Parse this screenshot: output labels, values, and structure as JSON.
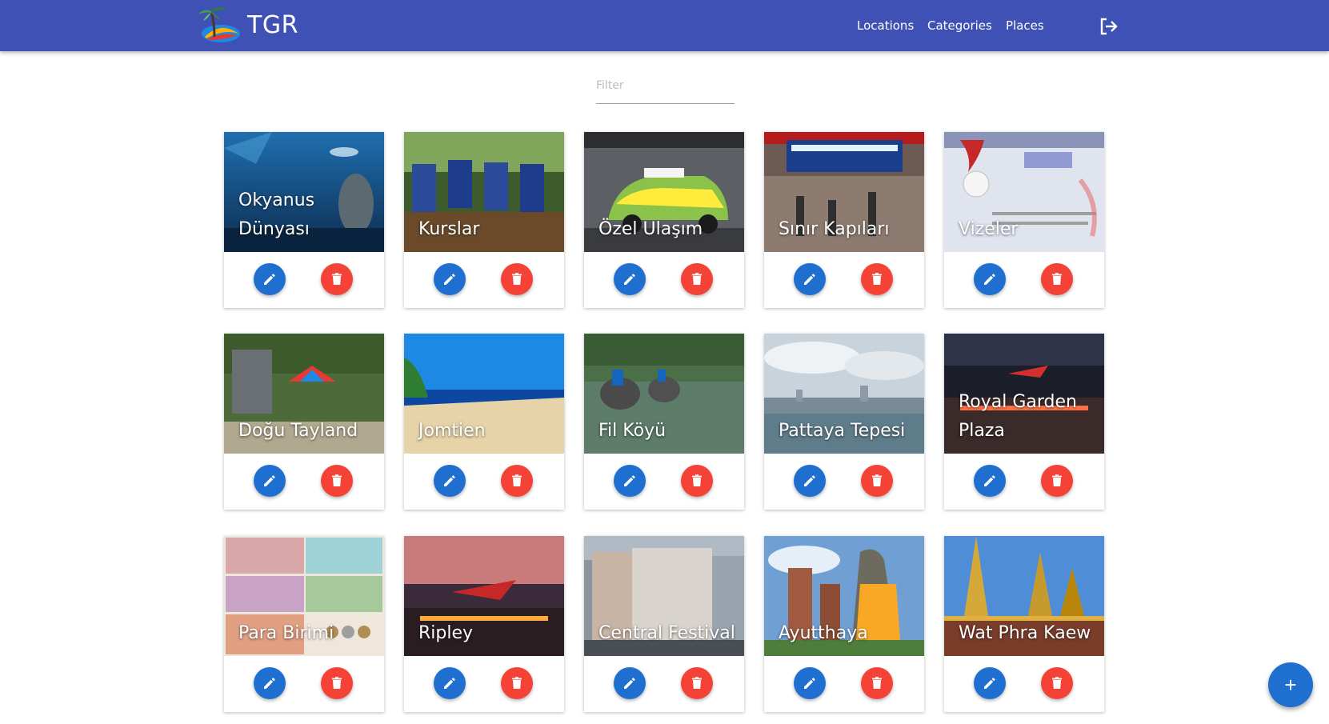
{
  "app": {
    "brand": "TGR"
  },
  "nav": {
    "locations": "Locations",
    "categories": "Categories",
    "places": "Places"
  },
  "filter": {
    "placeholder": "Filter"
  },
  "colors": {
    "navbar": "#3f51b5",
    "edit": "#1e6fd0",
    "delete": "#f44336"
  },
  "icons": {
    "edit": "pencil-icon",
    "delete": "trash-icon",
    "logout": "logout-icon",
    "add": "plus-icon"
  },
  "cards": [
    {
      "title": "Okyanus Dünyası"
    },
    {
      "title": "Kurslar"
    },
    {
      "title": "Özel Ulaşım"
    },
    {
      "title": "Sınır Kapıları"
    },
    {
      "title": "Vizeler"
    },
    {
      "title": "Doğu Tayland"
    },
    {
      "title": "Jomtien"
    },
    {
      "title": "Fil Köyü"
    },
    {
      "title": "Pattaya Tepesi"
    },
    {
      "title": "Royal Garden Plaza"
    },
    {
      "title": "Para Birimi"
    },
    {
      "title": "Ripley"
    },
    {
      "title": "Central Festival"
    },
    {
      "title": "Ayutthaya"
    },
    {
      "title": "Wat Phra Kaew"
    }
  ],
  "fab": {
    "label": "+"
  }
}
